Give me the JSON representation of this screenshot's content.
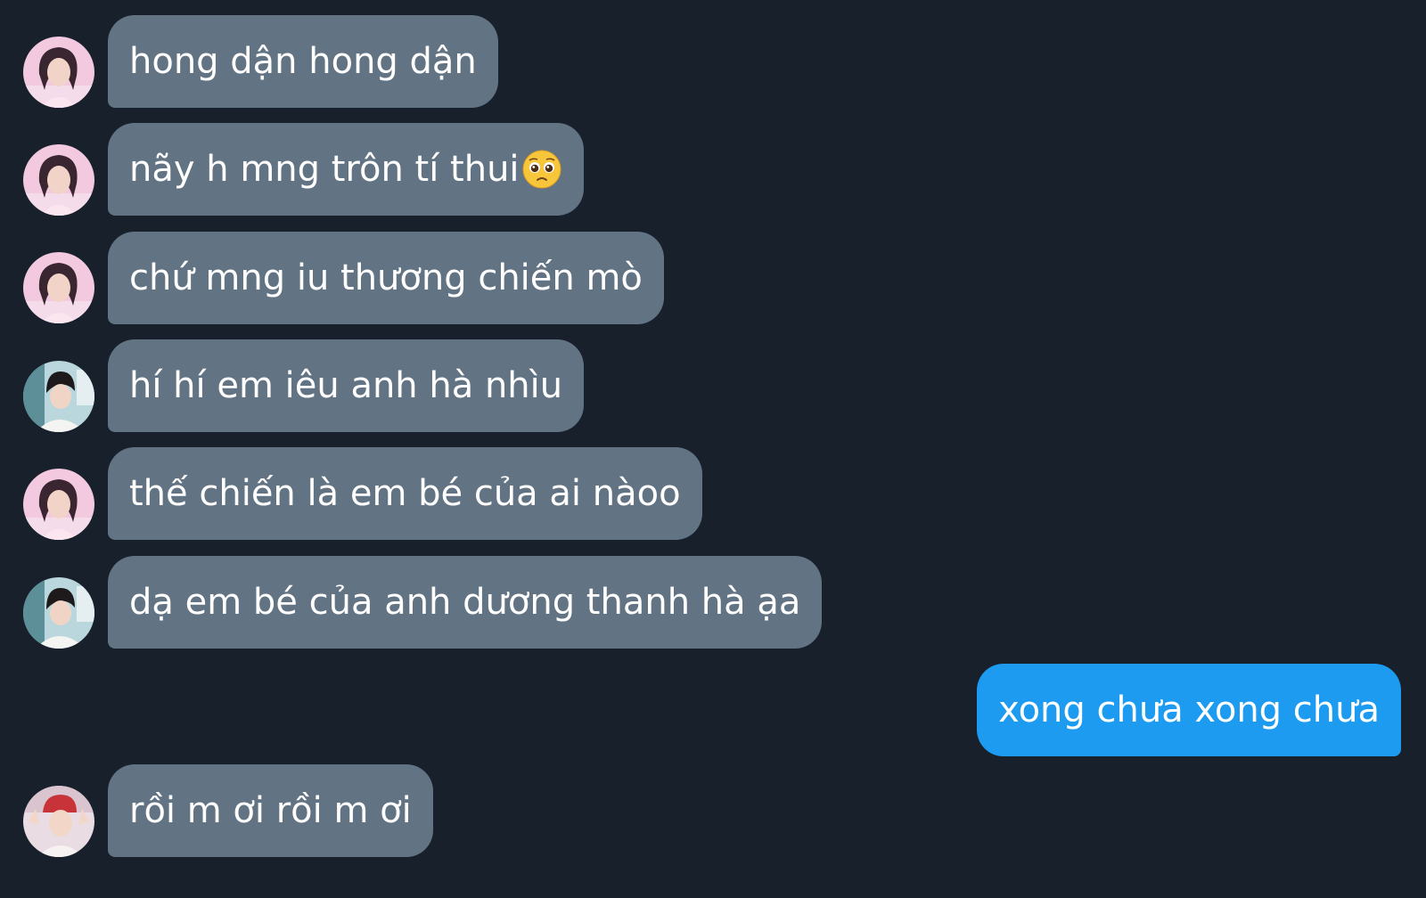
{
  "messages": [
    {
      "text": "hong dận hong dận",
      "emoji": null
    },
    {
      "text": "nãy h mng trôn tí thui",
      "emoji": "pleading-face-emoji"
    },
    {
      "text": "chứ mng iu thương chiến mò",
      "emoji": null
    },
    {
      "text": "hí hí em iêu anh hà nhìu",
      "emoji": null
    },
    {
      "text": "thế chiến là em bé của ai nàoo",
      "emoji": null
    },
    {
      "text": "dạ em bé của anh dương thanh hà ạa",
      "emoji": null
    },
    {
      "text": "xong chưa xong chưa",
      "emoji": null
    },
    {
      "text": "rồi m ơi rồi m ơi",
      "emoji": null
    }
  ],
  "colors": {
    "background": "#17202b",
    "incoming_bubble": "#627384",
    "outgoing_bubble": "#1d9bf0",
    "text": "#ffffff"
  }
}
